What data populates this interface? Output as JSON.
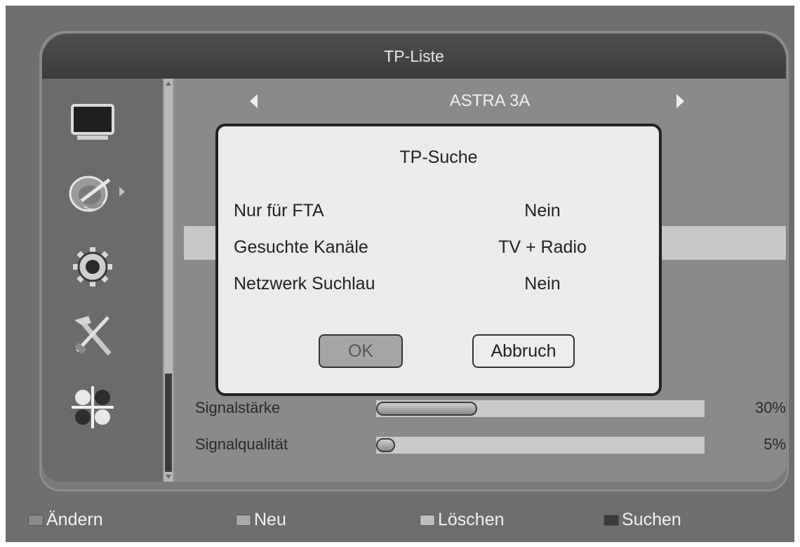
{
  "window": {
    "title": "TP-Liste"
  },
  "satellite": {
    "name": "ASTRA 3A"
  },
  "sidebar": {
    "items": [
      {
        "icon": "tv-icon"
      },
      {
        "icon": "satellite-dish-icon"
      },
      {
        "icon": "gear-icon"
      },
      {
        "icon": "tools-icon"
      },
      {
        "icon": "apps-grid-icon"
      }
    ]
  },
  "dialog": {
    "title": "TP-Suche",
    "options": [
      {
        "label": "Nur für FTA",
        "value": "Nein"
      },
      {
        "label": "Gesuchte Kanäle",
        "value": "TV + Radio"
      },
      {
        "label": "Netzwerk Suchlau",
        "value": "Nein"
      }
    ],
    "ok_label": "OK",
    "cancel_label": "Abbruch"
  },
  "signal": {
    "strength_label": "Signalstärke",
    "strength_value": "30%",
    "strength_fraction": 0.3,
    "quality_label": "Signalqualität",
    "quality_value": "5%",
    "quality_fraction": 0.05
  },
  "footer": {
    "items": [
      {
        "label": "Ändern",
        "color": "#8a8a8a"
      },
      {
        "label": "Neu",
        "color": "#a9a9a9"
      },
      {
        "label": "Löschen",
        "color": "#bdbdbd"
      },
      {
        "label": "Suchen",
        "color": "#3a3a3a"
      }
    ]
  }
}
